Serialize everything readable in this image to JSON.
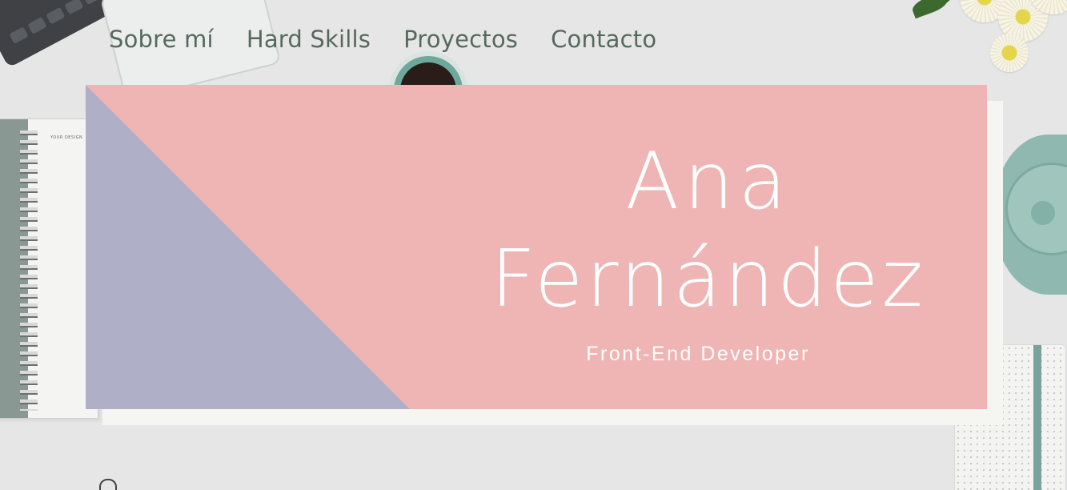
{
  "nav": {
    "items": [
      {
        "label": "Sobre mí"
      },
      {
        "label": "Hard Skills"
      },
      {
        "label": "Proyectos"
      },
      {
        "label": "Contacto"
      }
    ]
  },
  "hero": {
    "first_name": "Ana",
    "last_name": "Fernández",
    "role": "Front-End Developer"
  },
  "decor": {
    "notebook_label": "YOUR DESIGN"
  },
  "colors": {
    "card_pink": "#eeb5b4",
    "card_lavender": "#afb0c8",
    "nav_text": "#55695f",
    "hero_text": "#ffffff"
  }
}
